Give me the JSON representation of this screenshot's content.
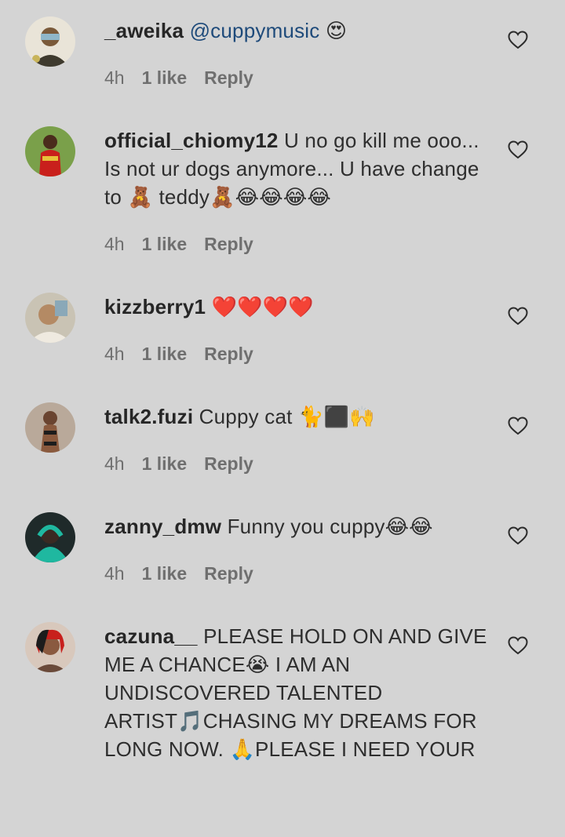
{
  "comments": [
    {
      "username": "_aweika",
      "mention": "@cuppymusic",
      "text": " 😍",
      "time": "4h",
      "likes": "1 like",
      "reply": "Reply"
    },
    {
      "username": "official_chiomy12",
      "mention": "",
      "text": " U no go kill me ooo... Is not ur dogs anymore... U have change to 🧸 teddy🧸😂😂😂😂",
      "time": "4h",
      "likes": "1 like",
      "reply": "Reply"
    },
    {
      "username": "kizzberry1",
      "mention": "",
      "text": " ❤️❤️❤️❤️",
      "time": "4h",
      "likes": "1 like",
      "reply": "Reply"
    },
    {
      "username": "talk2.fuzi",
      "mention": "",
      "text": " Cuppy cat 🐈⬛🙌",
      "time": "4h",
      "likes": "1 like",
      "reply": "Reply"
    },
    {
      "username": "zanny_dmw",
      "mention": "",
      "text": " Funny you cuppy😂😂",
      "time": "4h",
      "likes": "1 like",
      "reply": "Reply"
    },
    {
      "username": "cazuna__",
      "mention": "",
      "text": " PLEASE HOLD ON AND GIVE ME A CHANCE😭 I AM AN UNDISCOVERED TALENTED ARTIST🎵CHASING MY DREAMS FOR LONG NOW. 🙏PLEASE I NEED YOUR SUPPORT. A FOLLOW FROM YOU",
      "time": "",
      "likes": "",
      "reply": ""
    }
  ],
  "icons": {
    "like": "heart-outline-icon"
  },
  "colors": {
    "background": "#d4d4d4",
    "username": "#262626",
    "mention": "#1e4a7a",
    "meta": "#6f6f6f"
  }
}
